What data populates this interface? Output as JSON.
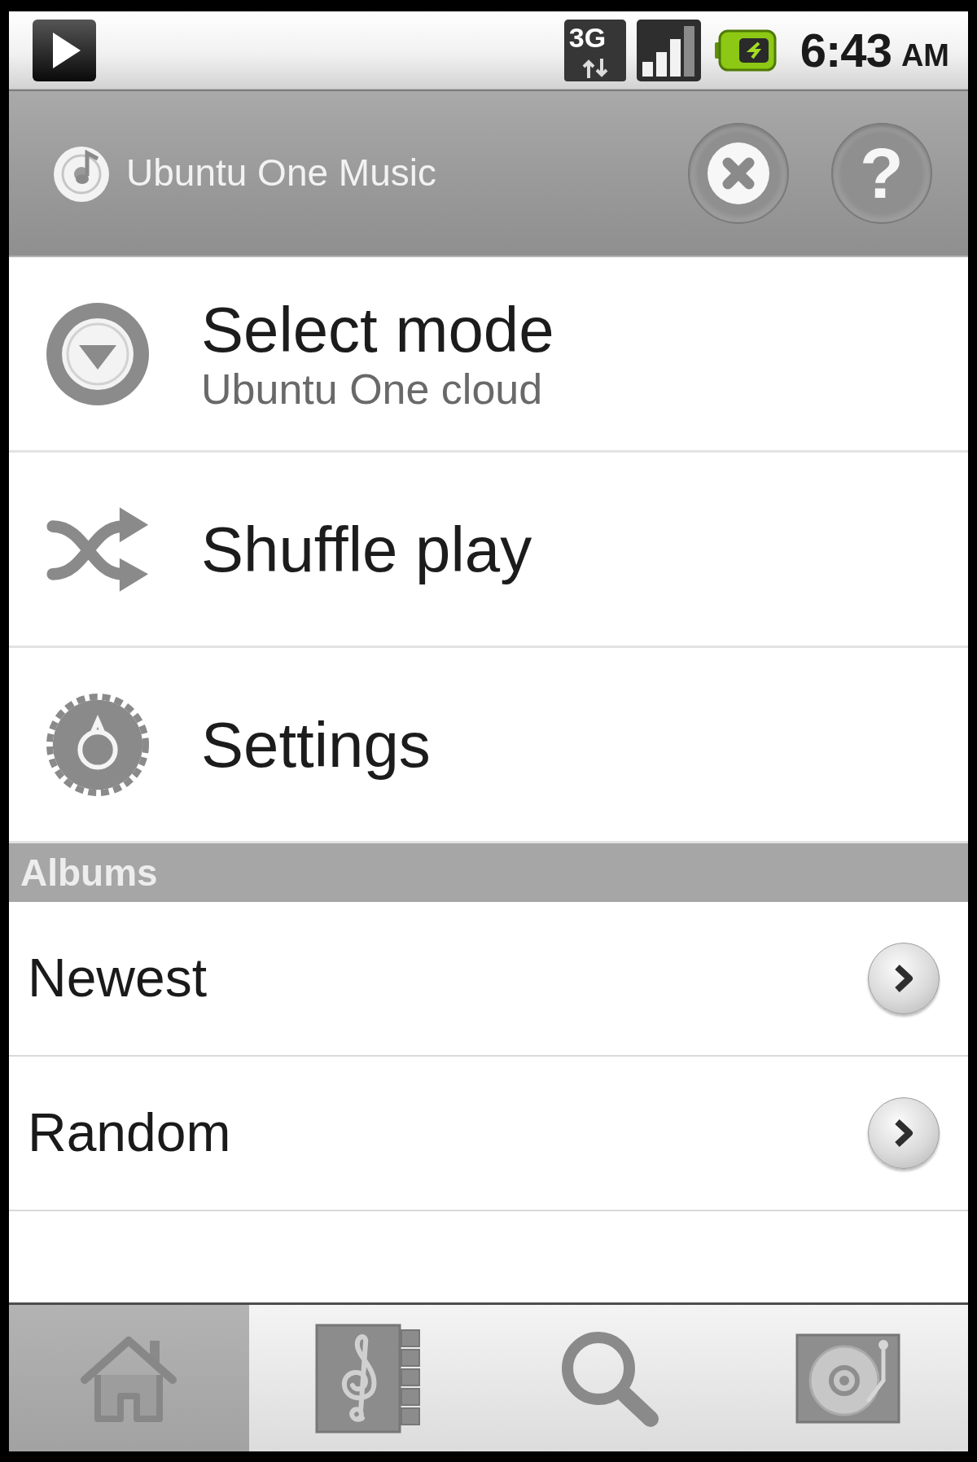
{
  "status_bar": {
    "network": "3G",
    "time": "6:43",
    "period": "AM"
  },
  "header": {
    "title": "Ubuntu One Music",
    "help_label": "?"
  },
  "menu": [
    {
      "kind": "mode",
      "title": "Select mode",
      "subtitle": "Ubuntu One cloud"
    },
    {
      "kind": "shuffle",
      "title": "Shuffle play"
    },
    {
      "kind": "settings",
      "title": "Settings"
    }
  ],
  "albums": {
    "heading": "Albums",
    "items": [
      {
        "label": "Newest"
      },
      {
        "label": "Random"
      }
    ]
  },
  "tabs": [
    {
      "kind": "home",
      "selected": true
    },
    {
      "kind": "library",
      "selected": false
    },
    {
      "kind": "search",
      "selected": false
    },
    {
      "kind": "now_playing",
      "selected": false
    }
  ]
}
